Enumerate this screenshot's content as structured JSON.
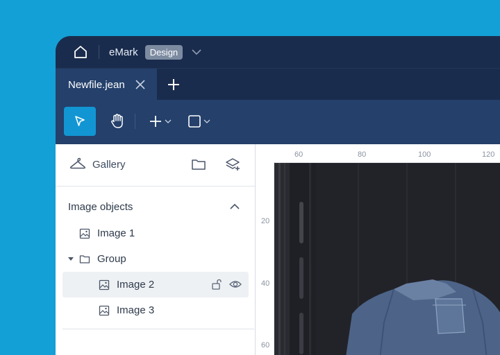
{
  "titlebar": {
    "app_name": "eMark",
    "mode_badge": "Design"
  },
  "tabs": [
    {
      "label": "Newfile.jean"
    }
  ],
  "toolbar": {
    "tools": [
      "select-tool",
      "hand-tool",
      "add-tool",
      "shape-tool"
    ]
  },
  "sidebar": {
    "gallery_label": "Gallery",
    "section_title": "Image objects",
    "items": [
      {
        "label": "Image 1",
        "type": "image",
        "level": 0
      },
      {
        "label": "Group",
        "type": "folder",
        "level": 0,
        "expanded": true
      },
      {
        "label": "Image 2",
        "type": "image",
        "level": 1,
        "selected": true
      },
      {
        "label": "Image 3",
        "type": "image",
        "level": 1
      }
    ]
  },
  "rulers": {
    "top": [
      "60",
      "80",
      "100",
      "120"
    ],
    "left": [
      "20",
      "40",
      "60"
    ]
  },
  "colors": {
    "background": "#13a0d6",
    "titlebar": "#1a2c4d",
    "toolbar": "#24406b",
    "accent": "#1296d3"
  }
}
